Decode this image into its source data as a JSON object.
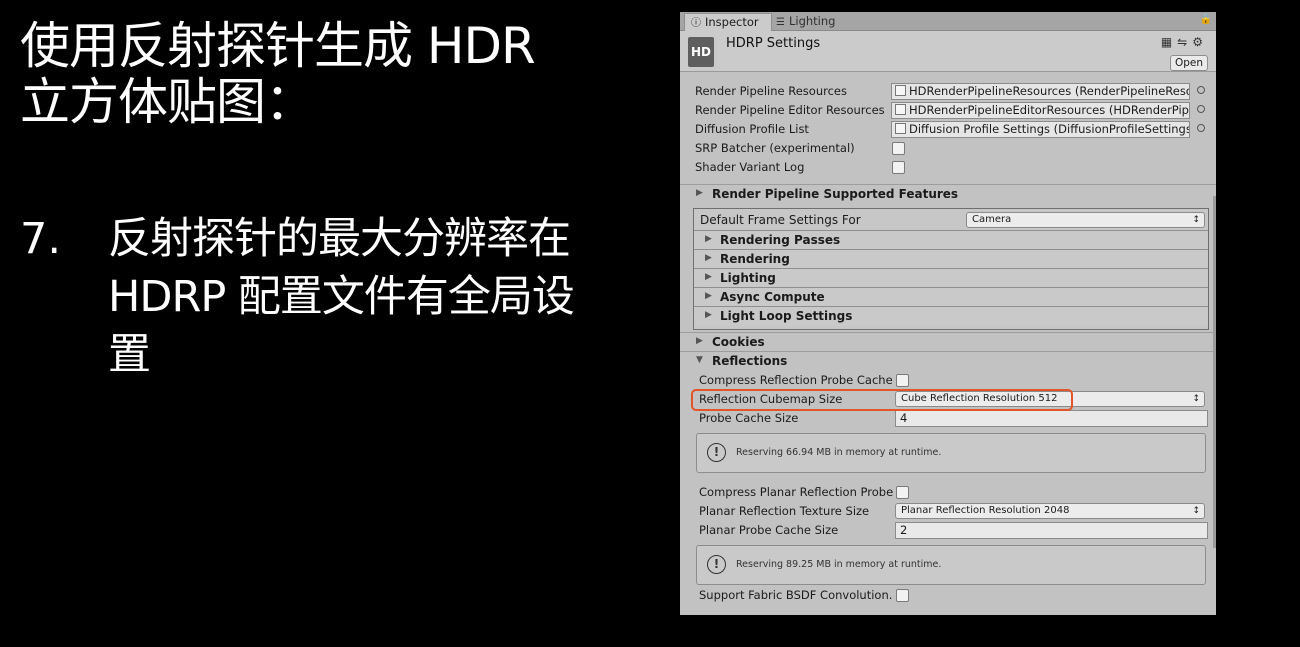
{
  "slide": {
    "title_line1": "使用反射探针生成 HDR",
    "title_line2": "立方体贴图：",
    "item_number": "7.",
    "item_line1": "反射探针的最大分辨率在",
    "item_line2": "HDRP 配置文件有全局设",
    "item_line3": "置"
  },
  "inspector": {
    "tabs": [
      {
        "label": "Inspector",
        "icon": "info-icon"
      },
      {
        "label": "Lighting",
        "icon": "lighting-icon"
      }
    ],
    "header": {
      "logo": "HD",
      "title": "HDRP Settings",
      "open_label": "Open"
    },
    "fields": [
      {
        "label": "Render Pipeline Resources",
        "value": "HDRenderPipelineResources (RenderPipelineResou"
      },
      {
        "label": "Render Pipeline Editor Resources",
        "value": "HDRenderPipelineEditorResources (HDRenderPipel"
      },
      {
        "label": "Diffusion Profile List",
        "value": "Diffusion Profile Settings (DiffusionProfileSettings)"
      }
    ],
    "toggles": [
      {
        "label": "SRP Batcher (experimental)",
        "checked": false
      },
      {
        "label": "Shader Variant Log",
        "checked": false
      }
    ],
    "supported_features": "Render Pipeline Supported Features",
    "frame_settings": {
      "label": "Default Frame Settings For",
      "selected": "Camera",
      "sections": [
        "Rendering Passes",
        "Rendering",
        "Lighting",
        "Async Compute",
        "Light Loop Settings"
      ]
    },
    "cookies": "Cookies",
    "reflections": {
      "title": "Reflections",
      "compress_label": "Compress Reflection Probe Cache",
      "cubemap_label": "Reflection Cubemap Size",
      "cubemap_value": "Cube Reflection Resolution 512",
      "cache_label": "Probe Cache Size",
      "cache_value": "4",
      "help1": "Reserving 66.94 MB in memory at runtime.",
      "planar_compress_label": "Compress Planar Reflection Probe (",
      "planar_texture_label": "Planar Reflection Texture Size",
      "planar_texture_value": "Planar Reflection Resolution 2048",
      "planar_cache_label": "Planar Probe Cache Size",
      "planar_cache_value": "2",
      "help2": "Reserving 89.25 MB in memory at runtime.",
      "fabric_label": "Support Fabric BSDF Convolution."
    }
  },
  "colors": {
    "slide_background": "#000000",
    "panel_background": "#c2c2c2",
    "highlight": "#e2542a"
  }
}
